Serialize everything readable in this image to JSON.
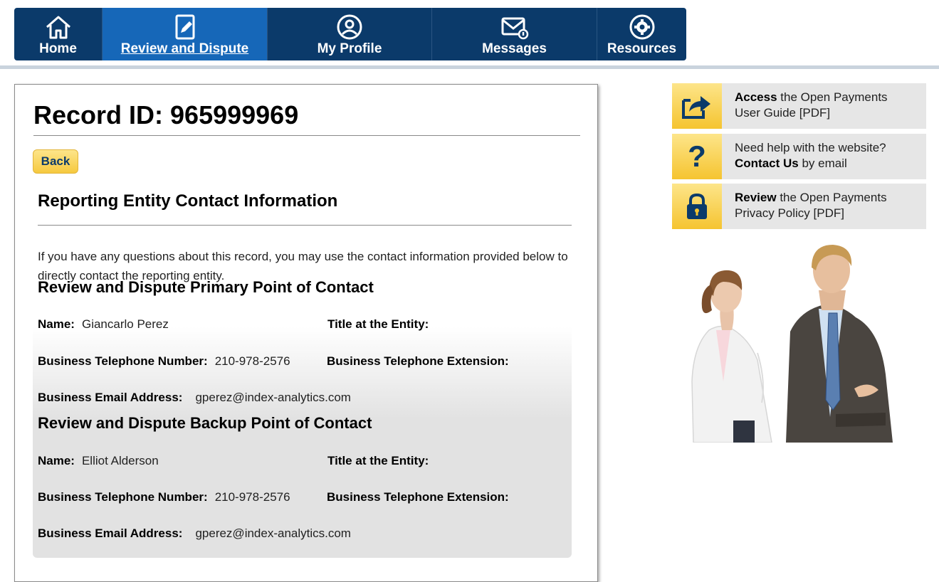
{
  "nav": {
    "items": [
      {
        "label": "Home",
        "icon": "home-icon"
      },
      {
        "label": "Review and Dispute",
        "icon": "document-edit-icon",
        "active": true
      },
      {
        "label": "My Profile",
        "icon": "user-icon"
      },
      {
        "label": "Messages",
        "icon": "envelope-icon"
      },
      {
        "label": "Resources",
        "icon": "gear-icon"
      }
    ]
  },
  "record": {
    "title": "Record ID: 965999969",
    "back_label": "Back"
  },
  "contact": {
    "section_title": "Reporting Entity Contact Information",
    "intro": "If you have any questions about this record, you may use the contact information provided below to directly contact the reporting entity.",
    "primary": {
      "heading": "Review and Dispute Primary Point of Contact",
      "name_label": "Name:",
      "name": "Giancarlo Perez",
      "title_label": "Title at the Entity:",
      "title": "",
      "phone_label": "Business Telephone Number:",
      "phone": "210-978-2576",
      "ext_label": "Business Telephone Extension:",
      "ext": "",
      "email_label": "Business Email Address:",
      "email": "gperez@index-analytics.com"
    },
    "backup": {
      "heading": "Review and Dispute Backup Point of Contact",
      "name_label": "Name:",
      "name": "Elliot Alderson",
      "title_label": "Title at the Entity:",
      "title": "",
      "phone_label": "Business Telephone Number:",
      "phone": "210-978-2576",
      "ext_label": "Business Telephone Extension:",
      "ext": "",
      "email_label": "Business Email Address:",
      "email": "gperez@index-analytics.com"
    }
  },
  "sidebar": {
    "links": [
      {
        "bold": "Access",
        "rest1": " the Open Payments",
        "line2": "User Guide [PDF]",
        "icon": "share-arrow-icon"
      },
      {
        "line1": "Need help with the website?",
        "bold": "Contact Us",
        "rest2": " by email",
        "icon": "question-mark-icon"
      },
      {
        "bold": "Review",
        "rest1": " the Open Payments",
        "line2": "Privacy Policy [PDF]",
        "icon": "lock-icon"
      }
    ]
  },
  "colors": {
    "nav_bg": "#0b3a6a",
    "nav_active": "#1667b8",
    "accent_yellow": "#f6c93f"
  }
}
